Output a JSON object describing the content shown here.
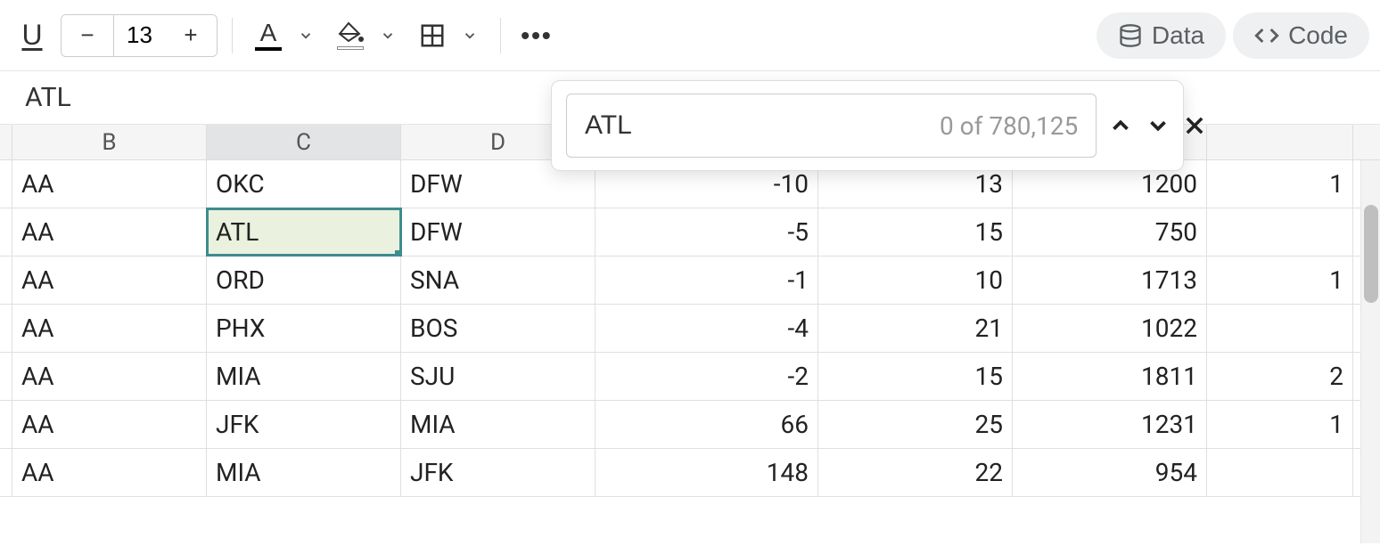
{
  "toolbar": {
    "font_size": "13",
    "data_label": "Data",
    "code_label": "Code"
  },
  "formula_bar": {
    "content": "ATL"
  },
  "columns": [
    "B",
    "C",
    "D"
  ],
  "selected_column": "C",
  "selected_cell": {
    "row": 1,
    "col": 1
  },
  "grid": {
    "rows": [
      {
        "B": "AA",
        "C": "OKC",
        "D": "DFW",
        "E": "-10",
        "F": "13",
        "G": "1200",
        "H": "1"
      },
      {
        "B": "AA",
        "C": "ATL",
        "D": "DFW",
        "E": "-5",
        "F": "15",
        "G": "750",
        "H": ""
      },
      {
        "B": "AA",
        "C": "ORD",
        "D": "SNA",
        "E": "-1",
        "F": "10",
        "G": "1713",
        "H": "1"
      },
      {
        "B": "AA",
        "C": "PHX",
        "D": "BOS",
        "E": "-4",
        "F": "21",
        "G": "1022",
        "H": ""
      },
      {
        "B": "AA",
        "C": "MIA",
        "D": "SJU",
        "E": "-2",
        "F": "15",
        "G": "1811",
        "H": "2"
      },
      {
        "B": "AA",
        "C": "JFK",
        "D": "MIA",
        "E": "66",
        "F": "25",
        "G": "1231",
        "H": "1"
      },
      {
        "B": "AA",
        "C": "MIA",
        "D": "JFK",
        "E": "148",
        "F": "22",
        "G": "954",
        "H": ""
      }
    ]
  },
  "find": {
    "query": "ATL",
    "result_text": "0 of 780,125"
  }
}
